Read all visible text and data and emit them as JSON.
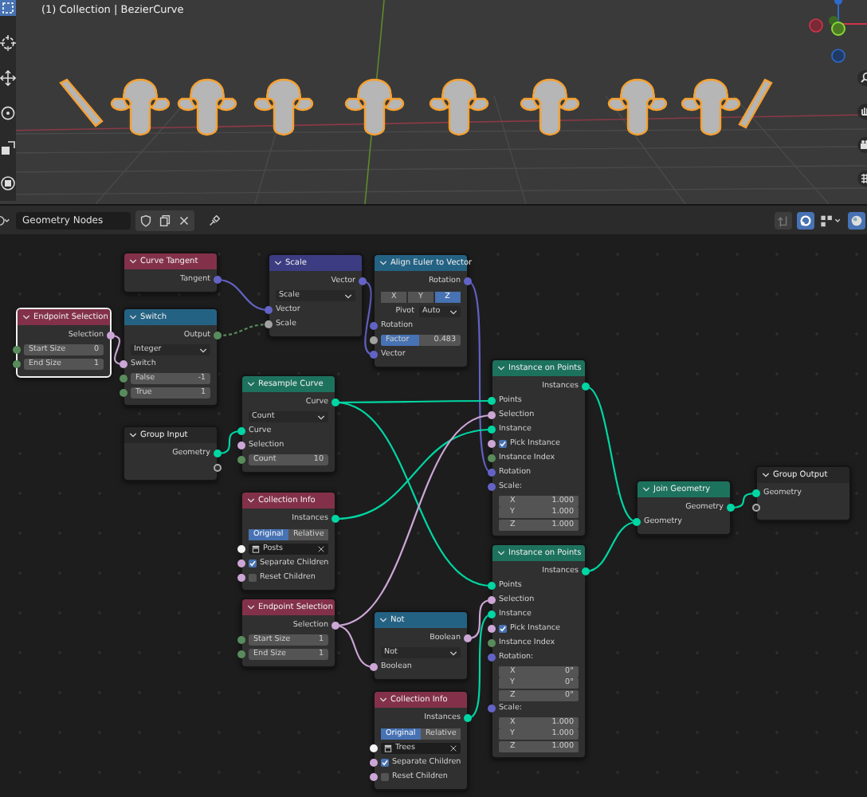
{
  "viewport": {
    "title": "(1) Collection | BezierCurve"
  },
  "editor_header": {
    "node_tree": {
      "value": "Geometry Nodes"
    }
  },
  "nodes": [
    {
      "title": "Curve Tangent",
      "color": "#83314a",
      "selected": false,
      "rows": [
        {
          "kind": "output",
          "label": "Tangent",
          "socket": {
            "color": "#6363c7"
          }
        }
      ]
    },
    {
      "title": "Scale",
      "color": "#3c3c83",
      "selected": false,
      "rows": [
        {
          "kind": "output",
          "label": "Vector",
          "socket": {
            "color": "#6363c7"
          }
        },
        {
          "kind": "dropdown",
          "value": "Scale"
        },
        {
          "kind": "input",
          "label": "Vector",
          "socket": {
            "color": "#6363c7"
          }
        },
        {
          "kind": "input",
          "label": "Scale",
          "socket": {
            "color": "#a1a1a1"
          }
        }
      ]
    },
    {
      "title": "Align Euler to Vector",
      "color": "#246283",
      "selected": false,
      "rows": [
        {
          "kind": "output",
          "label": "Rotation",
          "socket": {
            "color": "#6363c7"
          }
        },
        {
          "kind": "axes",
          "options": [
            {
              "label": "X",
              "selected": false
            },
            {
              "label": "Y",
              "selected": false
            },
            {
              "label": "Z",
              "selected": true
            }
          ]
        },
        {
          "kind": "labeled_dropdown",
          "label": "Pivot",
          "value": "Auto"
        },
        {
          "kind": "input",
          "label": "Rotation",
          "socket": {
            "color": "#6363c7"
          }
        },
        {
          "kind": "field",
          "label": "Factor",
          "value": "0.483",
          "level": 0.483,
          "socket": {
            "color": "#a1a1a1"
          }
        },
        {
          "kind": "input",
          "label": "Vector",
          "socket": {
            "color": "#6363c7"
          }
        }
      ]
    },
    {
      "title": "Endpoint Selection",
      "color": "#83314a",
      "selected": true,
      "rows": [
        {
          "kind": "output",
          "label": "Selection",
          "socket": {
            "color": "#cca6d6"
          }
        },
        {
          "kind": "field",
          "label": "Start Size",
          "value": "0",
          "socket": {
            "color": "#598c5c"
          }
        },
        {
          "kind": "field",
          "label": "End Size",
          "value": "1",
          "socket": {
            "color": "#598c5c"
          }
        }
      ]
    },
    {
      "title": "Switch",
      "color": "#246283",
      "selected": false,
      "rows": [
        {
          "kind": "output",
          "label": "Output",
          "socket": {
            "color": "#598c5c"
          }
        },
        {
          "kind": "dropdown",
          "value": "Integer"
        },
        {
          "kind": "input",
          "label": "Switch",
          "socket": {
            "color": "#cca6d6"
          }
        },
        {
          "kind": "field",
          "label": "False",
          "value": "-1",
          "socket": {
            "color": "#598c5c"
          }
        },
        {
          "kind": "field",
          "label": "True",
          "value": "1",
          "socket": {
            "color": "#598c5c"
          }
        }
      ]
    },
    {
      "title": "Resample Curve",
      "color": "#1d725e",
      "selected": false,
      "rows": [
        {
          "kind": "output",
          "label": "Curve",
          "socket": {
            "color": "#00d6a3"
          }
        },
        {
          "kind": "dropdown",
          "value": "Count"
        },
        {
          "kind": "input",
          "label": "Curve",
          "socket": {
            "color": "#00d6a3"
          }
        },
        {
          "kind": "input",
          "label": "Selection",
          "socket": {
            "color": "#cca6d6"
          }
        },
        {
          "kind": "field",
          "label": "Count",
          "value": "10",
          "socket": {
            "color": "#598c5c"
          }
        }
      ]
    },
    {
      "title": "Group Input",
      "color": "#272727",
      "selected": false,
      "rows": [
        {
          "kind": "output",
          "label": "Geometry",
          "socket": {
            "color": "#00d6a3"
          }
        },
        {
          "kind": "empty_output"
        }
      ]
    },
    {
      "title": "Collection Info",
      "color": "#83314a",
      "selected": false,
      "rows": [
        {
          "kind": "output",
          "label": "Instances",
          "socket": {
            "color": "#00d6a3"
          }
        },
        {
          "kind": "toggle",
          "options": [
            {
              "label": "Original",
              "selected": true
            },
            {
              "label": "Relative",
              "selected": false
            }
          ]
        },
        {
          "kind": "collection",
          "value": "Posts",
          "socket": {
            "color": "#f5f5f5"
          }
        },
        {
          "kind": "checkbox",
          "label": "Separate Children",
          "checked": true,
          "socket": {
            "color": "#cca6d6"
          }
        },
        {
          "kind": "checkbox",
          "label": "Reset Children",
          "checked": false,
          "socket": {
            "color": "#cca6d6"
          }
        }
      ]
    },
    {
      "title": "Endpoint Selection",
      "color": "#83314a",
      "selected": false,
      "rows": [
        {
          "kind": "output",
          "label": "Selection",
          "socket": {
            "color": "#cca6d6"
          }
        },
        {
          "kind": "field",
          "label": "Start Size",
          "value": "1",
          "socket": {
            "color": "#598c5c"
          }
        },
        {
          "kind": "field",
          "label": "End Size",
          "value": "1",
          "socket": {
            "color": "#598c5c"
          }
        }
      ]
    },
    {
      "title": "Not",
      "color": "#246283",
      "selected": false,
      "rows": [
        {
          "kind": "output",
          "label": "Boolean",
          "socket": {
            "color": "#cca6d6"
          }
        },
        {
          "kind": "dropdown",
          "value": "Not"
        },
        {
          "kind": "input",
          "label": "Boolean",
          "socket": {
            "color": "#cca6d6"
          }
        }
      ]
    },
    {
      "title": "Collection Info",
      "color": "#83314a",
      "selected": false,
      "rows": [
        {
          "kind": "output",
          "label": "Instances",
          "socket": {
            "color": "#00d6a3"
          }
        },
        {
          "kind": "toggle",
          "options": [
            {
              "label": "Original",
              "selected": true
            },
            {
              "label": "Relative",
              "selected": false
            }
          ]
        },
        {
          "kind": "collection",
          "value": "Trees",
          "socket": {
            "color": "#f5f5f5"
          }
        },
        {
          "kind": "checkbox",
          "label": "Separate Children",
          "checked": true,
          "socket": {
            "color": "#cca6d6"
          }
        },
        {
          "kind": "checkbox",
          "label": "Reset Children",
          "checked": false,
          "socket": {
            "color": "#cca6d6"
          }
        }
      ]
    },
    {
      "title": "Instance on Points",
      "color": "#1d725e",
      "selected": false,
      "rows": [
        {
          "kind": "output",
          "label": "Instances",
          "socket": {
            "color": "#00d6a3"
          }
        },
        {
          "kind": "input",
          "label": "Points",
          "socket": {
            "color": "#00d6a3"
          }
        },
        {
          "kind": "input",
          "label": "Selection",
          "socket": {
            "color": "#cca6d6"
          }
        },
        {
          "kind": "input",
          "label": "Instance",
          "socket": {
            "color": "#00d6a3"
          }
        },
        {
          "kind": "checkbox",
          "label": "Pick Instance",
          "checked": true,
          "socket": {
            "color": "#cca6d6"
          }
        },
        {
          "kind": "input",
          "label": "Instance Index",
          "socket": {
            "color": "#598c5c"
          }
        },
        {
          "kind": "input",
          "label": "Rotation",
          "socket": {
            "color": "#6363c7"
          }
        },
        {
          "kind": "input",
          "label": "Scale:",
          "socket": {
            "color": "#6363c7"
          }
        },
        {
          "kind": "vector",
          "items": [
            {
              "label": "X",
              "value": "1.000"
            },
            {
              "label": "Y",
              "value": "1.000"
            },
            {
              "label": "Z",
              "value": "1.000"
            }
          ]
        }
      ]
    },
    {
      "title": "Instance on Points",
      "color": "#1d725e",
      "selected": false,
      "rows": [
        {
          "kind": "output",
          "label": "Instances",
          "socket": {
            "color": "#00d6a3"
          }
        },
        {
          "kind": "input",
          "label": "Points",
          "socket": {
            "color": "#00d6a3"
          }
        },
        {
          "kind": "input",
          "label": "Selection",
          "socket": {
            "color": "#cca6d6"
          }
        },
        {
          "kind": "input",
          "label": "Instance",
          "socket": {
            "color": "#00d6a3"
          }
        },
        {
          "kind": "checkbox",
          "label": "Pick Instance",
          "checked": true,
          "socket": {
            "color": "#cca6d6"
          }
        },
        {
          "kind": "input",
          "label": "Instance Index",
          "socket": {
            "color": "#598c5c"
          }
        },
        {
          "kind": "input",
          "label": "Rotation:",
          "socket": {
            "color": "#6363c7"
          }
        },
        {
          "kind": "vector",
          "items": [
            {
              "label": "X",
              "value": "0°"
            },
            {
              "label": "Y",
              "value": "0°"
            },
            {
              "label": "Z",
              "value": "0°"
            }
          ]
        },
        {
          "kind": "input",
          "label": "Scale:",
          "socket": {
            "color": "#6363c7"
          }
        },
        {
          "kind": "vector",
          "items": [
            {
              "label": "X",
              "value": "1.000"
            },
            {
              "label": "Y",
              "value": "1.000"
            },
            {
              "label": "Z",
              "value": "1.000"
            }
          ]
        }
      ]
    },
    {
      "title": "Join Geometry",
      "color": "#1d725e",
      "selected": false,
      "rows": [
        {
          "kind": "output",
          "label": "Geometry",
          "socket": {
            "color": "#00d6a3"
          }
        },
        {
          "kind": "input",
          "label": "Geometry",
          "socket": {
            "color": "#00d6a3"
          }
        }
      ]
    },
    {
      "title": "Group Output",
      "color": "#272727",
      "selected": false,
      "rows": [
        {
          "kind": "input",
          "label": "Geometry",
          "socket": {
            "color": "#00d6a3"
          }
        },
        {
          "kind": "empty_input"
        }
      ]
    }
  ]
}
